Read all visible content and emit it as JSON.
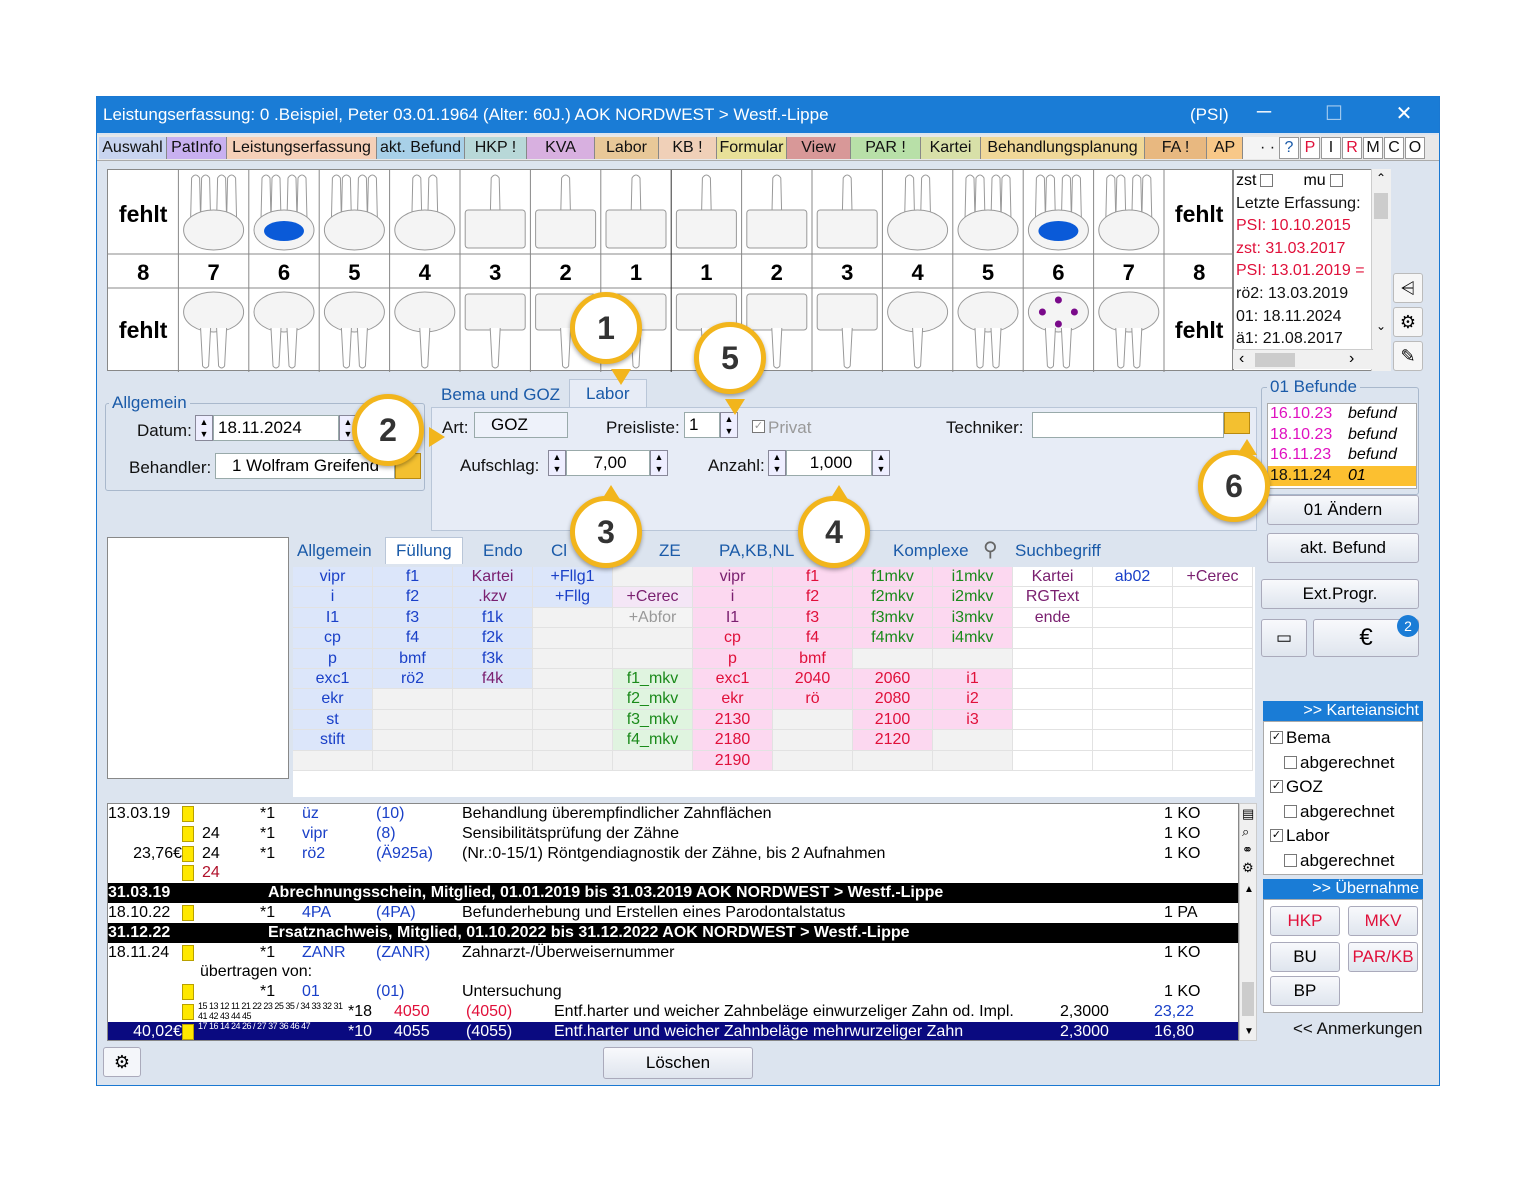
{
  "window": {
    "title": "Leistungserfassung: 0  .Beispiel, Peter  03.01.1964 (Alter: 60J.)  AOK NORDWEST > Westf.-Lippe",
    "psi": "(PSI)",
    "min": "─",
    "max": "☐",
    "close": "✕"
  },
  "tabs": [
    {
      "label": "Auswahl",
      "color": "#c8d4f0"
    },
    {
      "label": "PatInfo",
      "color": "#c8b0f0"
    },
    {
      "label": "Leistungserfassung",
      "color": "#f5d0b8"
    },
    {
      "label": "akt. Befund",
      "color": "#a8d0e8"
    },
    {
      "label": "HKP !",
      "color": "#b8d8d8"
    },
    {
      "label": "KVA",
      "color": "#d8b0e0"
    },
    {
      "label": "Labor",
      "color": "#e8c898"
    },
    {
      "label": "KB !",
      "color": "#f0d0b8"
    },
    {
      "label": "Formular",
      "color": "#e8e098"
    },
    {
      "label": "View",
      "color": "#d89898"
    },
    {
      "label": "PAR !",
      "color": "#b8e0a8"
    },
    {
      "label": "Kartei",
      "color": "#d8e0a8"
    },
    {
      "label": "Behandlungsplanung",
      "color": "#f0d898"
    },
    {
      "label": "FA !",
      "color": "#e8b880"
    },
    {
      "label": "AP",
      "color": "#f8c888"
    }
  ],
  "tab_more": "· ·",
  "pbuttons": [
    "?",
    "P",
    "I",
    "R",
    "M",
    "C",
    "O"
  ],
  "teeth": {
    "upper_nums": [
      "8",
      "7",
      "6",
      "5",
      "4",
      "3",
      "2",
      "1",
      "1",
      "2",
      "3",
      "4",
      "5",
      "6",
      "7",
      "8"
    ],
    "missing": "fehlt"
  },
  "log": {
    "zst": "zst",
    "mu": "mu",
    "lines": [
      {
        "t": "Letzte Erfassung:",
        "c": "#111"
      },
      {
        "t": "PSI: 10.10.2015",
        "c": "#e0103a"
      },
      {
        "t": "zst: 31.03.2017",
        "c": "#e0103a"
      },
      {
        "t": "PSI: 13.01.2019 =",
        "c": "#e0103a"
      },
      {
        "t": "rö2: 13.03.2019",
        "c": "#111"
      },
      {
        "t": "01: 18.11.2024",
        "c": "#111"
      },
      {
        "t": "ä1: 21.08.2017",
        "c": "#111"
      }
    ]
  },
  "allgemein": {
    "title": "Allgemein",
    "datum_label": "Datum:",
    "datum": "18.11.2024",
    "behandler_label": "Behandler:",
    "behandler": "1 Wolfram Greifend"
  },
  "labor_tabs": {
    "bema": "Bema und GOZ",
    "labor": "Labor"
  },
  "labor": {
    "art_label": "Art:",
    "art": "GOZ",
    "preisliste_label": "Preisliste:",
    "preisliste": "1",
    "privat": "Privat",
    "techniker_label": "Techniker:",
    "techniker": "",
    "aufschlag_label": "Aufschlag:",
    "aufschlag": "7,00",
    "anzahl_label": "Anzahl:",
    "anzahl": "1,000"
  },
  "dtabs": [
    "Allgemein",
    "Füllung",
    "Endo",
    "Cl",
    "ZE",
    "PA,KB,NL",
    "Komplexe",
    "Suchbegriff"
  ],
  "grid": [
    [
      [
        "vipr",
        "blue"
      ],
      [
        "f1",
        "blue"
      ],
      [
        "Kartei",
        "pur"
      ],
      [
        "+Fllg1",
        "blue"
      ],
      [
        "",
        ""
      ],
      [
        "vipr",
        "pur"
      ],
      [
        "f1",
        "red"
      ],
      [
        "f1mkv",
        "grn"
      ],
      [
        "i1mkv",
        "grn"
      ],
      [
        "Kartei",
        "pur"
      ],
      [
        "ab02",
        "blue"
      ],
      [
        "+Cerec",
        "pur"
      ]
    ],
    [
      [
        "i",
        "blue"
      ],
      [
        "f2",
        "blue"
      ],
      [
        ".kzv",
        "pur"
      ],
      [
        "+Fllg",
        "blue"
      ],
      [
        "+Cerec",
        "pur"
      ],
      [
        "i",
        "pur"
      ],
      [
        "f2",
        "red"
      ],
      [
        "f2mkv",
        "grn"
      ],
      [
        "i2mkv",
        "grn"
      ],
      [
        "RGText",
        "pur"
      ],
      [
        "",
        ""
      ],
      [
        "",
        ""
      ]
    ],
    [
      [
        "I1",
        "blue"
      ],
      [
        "f3",
        "blue"
      ],
      [
        "f1k",
        "blue"
      ],
      [
        "",
        ""
      ],
      [
        "+Abfor",
        "gry"
      ],
      [
        "I1",
        "pur"
      ],
      [
        "f3",
        "red"
      ],
      [
        "f3mkv",
        "grn"
      ],
      [
        "i3mkv",
        "grn"
      ],
      [
        "ende",
        "pur"
      ],
      [
        "",
        ""
      ],
      [
        "",
        ""
      ]
    ],
    [
      [
        "cp",
        "blue"
      ],
      [
        "f4",
        "blue"
      ],
      [
        "f2k",
        "blue"
      ],
      [
        "",
        ""
      ],
      [
        "",
        ""
      ],
      [
        "cp",
        "red"
      ],
      [
        "f4",
        "red"
      ],
      [
        "f4mkv",
        "grn"
      ],
      [
        "i4mkv",
        "grn"
      ],
      [
        "",
        ""
      ],
      [
        "",
        ""
      ],
      [
        "",
        ""
      ]
    ],
    [
      [
        "p",
        "blue"
      ],
      [
        "bmf",
        "blue"
      ],
      [
        "f3k",
        "blue"
      ],
      [
        "",
        ""
      ],
      [
        "",
        ""
      ],
      [
        "p",
        "red"
      ],
      [
        "bmf",
        "red"
      ],
      [
        "",
        ""
      ],
      [
        "",
        ""
      ],
      [
        "",
        ""
      ],
      [
        "",
        ""
      ],
      [
        "",
        ""
      ]
    ],
    [
      [
        "exc1",
        "blue"
      ],
      [
        "rö2",
        "blue"
      ],
      [
        "f4k",
        "pur"
      ],
      [
        "",
        ""
      ],
      [
        "f1_mkv",
        "grn"
      ],
      [
        "exc1",
        "red"
      ],
      [
        "2040",
        "red"
      ],
      [
        "2060",
        "red"
      ],
      [
        "i1",
        "red"
      ],
      [
        "",
        ""
      ],
      [
        "",
        ""
      ],
      [
        "",
        ""
      ]
    ],
    [
      [
        "ekr",
        "blue"
      ],
      [
        "",
        ""
      ],
      [
        "",
        ""
      ],
      [
        "",
        ""
      ],
      [
        "f2_mkv",
        "grn"
      ],
      [
        "ekr",
        "red"
      ],
      [
        "rö",
        "red"
      ],
      [
        "2080",
        "red"
      ],
      [
        "i2",
        "red"
      ],
      [
        "",
        ""
      ],
      [
        "",
        ""
      ],
      [
        "",
        ""
      ]
    ],
    [
      [
        "st",
        "blue"
      ],
      [
        "",
        ""
      ],
      [
        "",
        ""
      ],
      [
        "",
        ""
      ],
      [
        "f3_mkv",
        "grn"
      ],
      [
        "2130",
        "red"
      ],
      [
        "",
        ""
      ],
      [
        "2100",
        "red"
      ],
      [
        "i3",
        "red"
      ],
      [
        "",
        ""
      ],
      [
        "",
        ""
      ],
      [
        "",
        ""
      ]
    ],
    [
      [
        "stift",
        "blue"
      ],
      [
        "",
        ""
      ],
      [
        "",
        ""
      ],
      [
        "",
        ""
      ],
      [
        "f4_mkv",
        "grn"
      ],
      [
        "2180",
        "red"
      ],
      [
        "",
        ""
      ],
      [
        "2120",
        "red"
      ],
      [
        "",
        ""
      ],
      [
        "",
        ""
      ],
      [
        "",
        ""
      ],
      [
        "",
        ""
      ]
    ],
    [
      [
        "",
        ""
      ],
      [
        "",
        ""
      ],
      [
        "",
        ""
      ],
      [
        "",
        ""
      ],
      [
        "",
        ""
      ],
      [
        "2190",
        "red"
      ],
      [
        "",
        ""
      ],
      [
        "",
        ""
      ],
      [
        "",
        ""
      ],
      [
        "",
        ""
      ],
      [
        "",
        ""
      ],
      [
        "",
        ""
      ]
    ]
  ],
  "list": [
    {
      "date": "13.03.19",
      "amt": "",
      "tooth": "",
      "mult": "*1",
      "code": "üz",
      "ref": "(10)",
      "desc": "Behandlung überempfindlicher Zahnflächen",
      "fac": "",
      "qty": "1 KO",
      "type": "n"
    },
    {
      "date": "",
      "amt": "",
      "tooth": "24",
      "mult": "*1",
      "code": "vipr",
      "ref": "(8)",
      "desc": "Sensibilitätsprüfung der Zähne",
      "fac": "",
      "qty": "1 KO",
      "type": "n"
    },
    {
      "date": "",
      "amt": "23,76€",
      "tooth": "24",
      "mult": "*1",
      "code": "rö2",
      "ref": "(Ä925a)",
      "desc": "(Nr.:0-15/1) Röntgendiagnostik der Zähne, bis 2 Aufnahmen",
      "fac": "",
      "qty": "1 KO",
      "type": "n"
    },
    {
      "date": "",
      "amt": "",
      "tooth": "24",
      "mult": "",
      "code": "",
      "ref": "",
      "desc": "",
      "fac": "",
      "qty": "",
      "type": "r"
    },
    {
      "date": "31.03.19",
      "desc": "Abrechnungsschein, Mitglied, 01.01.2019 bis 31.03.2019  AOK NORDWEST > Westf.-Lippe",
      "type": "b"
    },
    {
      "date": "18.10.22",
      "amt": "",
      "tooth": "",
      "mult": "*1",
      "code": "4PA",
      "ref": "(4PA)",
      "desc": "Befunderhebung und Erstellen eines Parodontalstatus",
      "fac": "",
      "qty": "1 PA",
      "type": "n"
    },
    {
      "date": "31.12.22",
      "desc": "Ersatznachweis, Mitglied, 01.10.2022 bis 31.12.2022  AOK NORDWEST > Westf.-Lippe",
      "type": "b"
    },
    {
      "date": "18.11.24",
      "amt": "",
      "tooth": "",
      "mult": "*1",
      "code": "ZANR",
      "ref": "(ZANR)",
      "desc": "Zahnarzt-/Überweisernummer",
      "fac": "",
      "qty": "1 KO",
      "type": "n"
    },
    {
      "date": "",
      "amt": "übertragen von:",
      "tooth": "",
      "mult": "",
      "code": "",
      "ref": "",
      "desc": "",
      "fac": "",
      "qty": "",
      "type": "t"
    },
    {
      "date": "",
      "amt": "",
      "tooth": "",
      "mult": "*1",
      "code": "01",
      "ref": "(01)",
      "desc": "Untersuchung",
      "fac": "",
      "qty": "1 KO",
      "type": "n"
    },
    {
      "date": "",
      "amt": "",
      "tooth": "15 13 12 11 21 22 23 25 35 / 34 33 32 31 41 42 43 44 45",
      "mult": "*18",
      "code": "4050",
      "ref": "(4050)",
      "desc": "Entf.harter und weicher Zahnbeläge einwurzeliger Zahn od. Impl.",
      "fac": "2,3000",
      "qty": "23,22",
      "type": "g"
    },
    {
      "date": "",
      "amt": "40,02€",
      "tooth": "17 16 14 24 26 / 27 37 36 46 47",
      "mult": "*10",
      "code": "4055",
      "ref": "(4055)",
      "desc": "Entf.harter und weicher Zahnbeläge mehrwurzeliger Zahn",
      "fac": "2,3000",
      "qty": "16,80",
      "type": "s"
    }
  ],
  "befunde": {
    "title": "01 Befunde",
    "items": [
      {
        "d": "16.10.23",
        "t": "befund"
      },
      {
        "d": "18.10.23",
        "t": "befund"
      },
      {
        "d": "16.11.23",
        "t": "befund"
      },
      {
        "d": "18.11.24",
        "t": "01"
      }
    ]
  },
  "buttons": {
    "aendern": "01 Ändern",
    "akt": "akt. Befund",
    "ext": "Ext.Progr.",
    "loeschen": "Löschen",
    "badge": "2"
  },
  "kartei": {
    "header": ">> Karteiansicht",
    "items": [
      {
        "l": "Bema",
        "c": true
      },
      {
        "l": "abgerechnet",
        "c": false
      },
      {
        "l": "GOZ",
        "c": true
      },
      {
        "l": "abgerechnet",
        "c": false
      },
      {
        "l": "Labor",
        "c": true
      },
      {
        "l": "abgerechnet",
        "c": false
      }
    ]
  },
  "uebernahme": {
    "header": ">> Übernahme",
    "btns": [
      "HKP",
      "MKV",
      "BU",
      "PAR/KB",
      "BP"
    ]
  },
  "anmerkungen": "<< Anmerkungen",
  "callouts": [
    "1",
    "2",
    "3",
    "4",
    "5",
    "6"
  ]
}
